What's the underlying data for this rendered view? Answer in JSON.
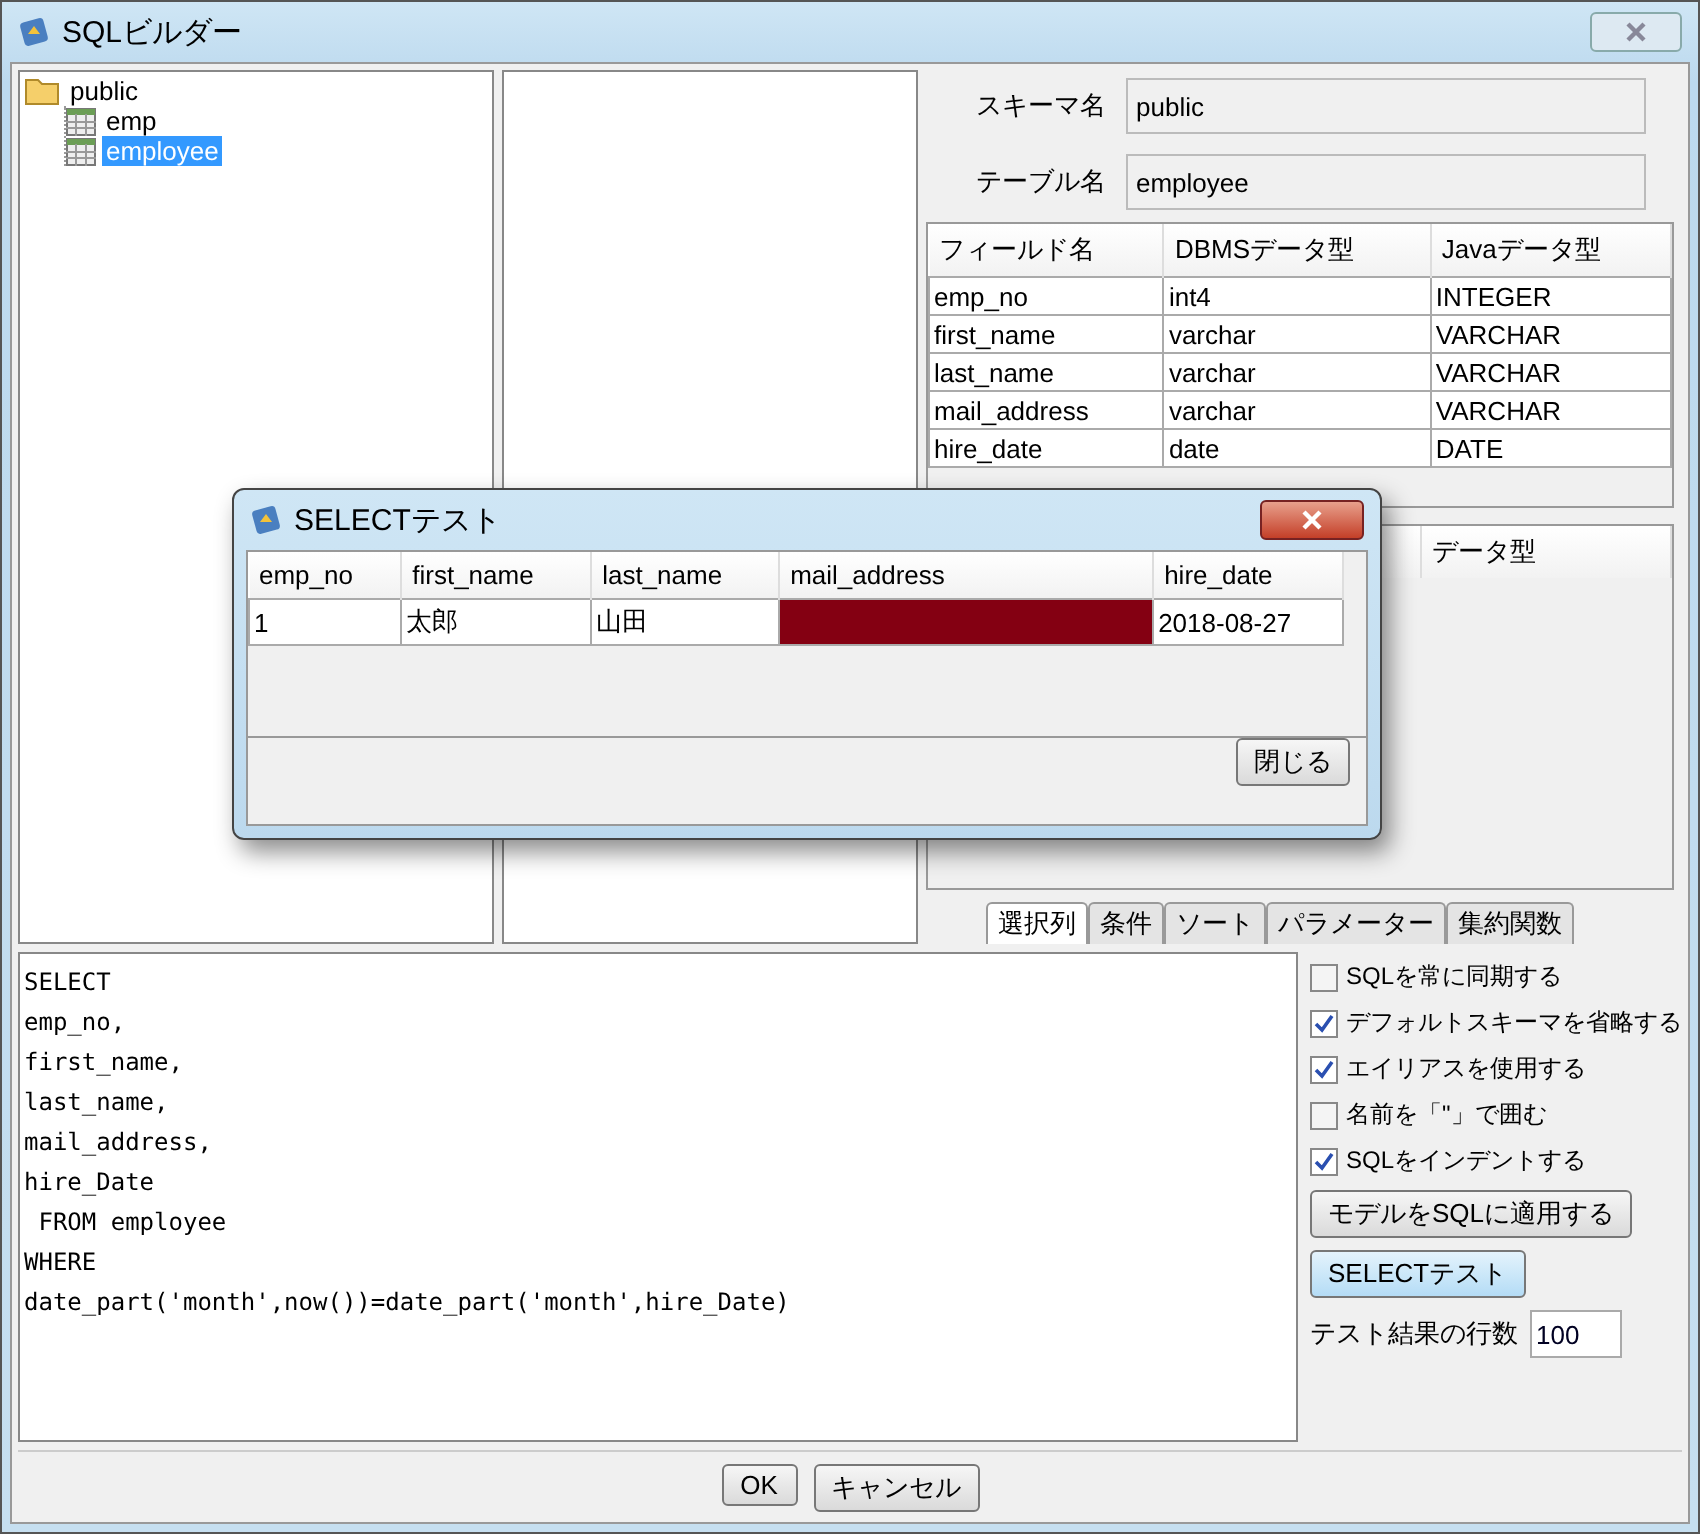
{
  "window": {
    "title": "SQLビルダー"
  },
  "tree": [
    {
      "label": "public",
      "kind": "folder",
      "selected": false,
      "children": [
        {
          "label": "emp",
          "kind": "table",
          "selected": false
        },
        {
          "label": "employee",
          "kind": "table",
          "selected": true
        }
      ]
    }
  ],
  "schema": {
    "schema_label": "スキーマ名",
    "schema_value": "public",
    "table_label": "テーブル名",
    "table_value": "employee"
  },
  "fields_table": {
    "columns": [
      "フィールド名",
      "DBMSデータ型",
      "Javaデータ型"
    ],
    "rows": [
      [
        "emp_no",
        "int4",
        "INTEGER"
      ],
      [
        "first_name",
        "varchar",
        "VARCHAR"
      ],
      [
        "last_name",
        "varchar",
        "VARCHAR"
      ],
      [
        "mail_address",
        "varchar",
        "VARCHAR"
      ],
      [
        "hire_date",
        "date",
        "DATE"
      ]
    ]
  },
  "lower_table": {
    "columns": [
      "データ型"
    ]
  },
  "tabs": [
    {
      "label": "選択列",
      "selected": true
    },
    {
      "label": "条件",
      "selected": false
    },
    {
      "label": "ソート",
      "selected": false
    },
    {
      "label": "パラメーター",
      "selected": false
    },
    {
      "label": "集約関数",
      "selected": false
    }
  ],
  "sql": [
    "SELECT",
    "emp_no,",
    "first_name,",
    "last_name,",
    "mail_address,",
    "hire_Date",
    " FROM employee",
    "WHERE",
    "date_part('month',now())=date_part('month',hire_Date)"
  ],
  "options": [
    {
      "label": "SQLを常に同期する",
      "checked": false
    },
    {
      "label": "デフォルトスキーマを省略する",
      "checked": true
    },
    {
      "label": "エイリアスを使用する",
      "checked": true
    },
    {
      "label": "名前を「\"」で囲む",
      "checked": false
    },
    {
      "label": "SQLをインデントする",
      "checked": true
    }
  ],
  "apply_button": "モデルをSQLに適用する",
  "select_test_button": "SELECTテスト",
  "row_count": {
    "label": "テスト結果の行数",
    "value": "100"
  },
  "footer_buttons": [
    "OK",
    "キャンセル"
  ],
  "dialog": {
    "title": "SELECTテスト",
    "columns": [
      "emp_no",
      "first_name",
      "last_name",
      "mail_address",
      "hire_date"
    ],
    "rows": [
      [
        {
          "kind": "text",
          "text": "1"
        },
        {
          "kind": "text",
          "text": "太郎"
        },
        {
          "kind": "text",
          "text": "山田"
        },
        {
          "kind": "redacted"
        },
        {
          "kind": "text",
          "text": "2018-08-27"
        }
      ]
    ],
    "close_button": "閉じる"
  }
}
